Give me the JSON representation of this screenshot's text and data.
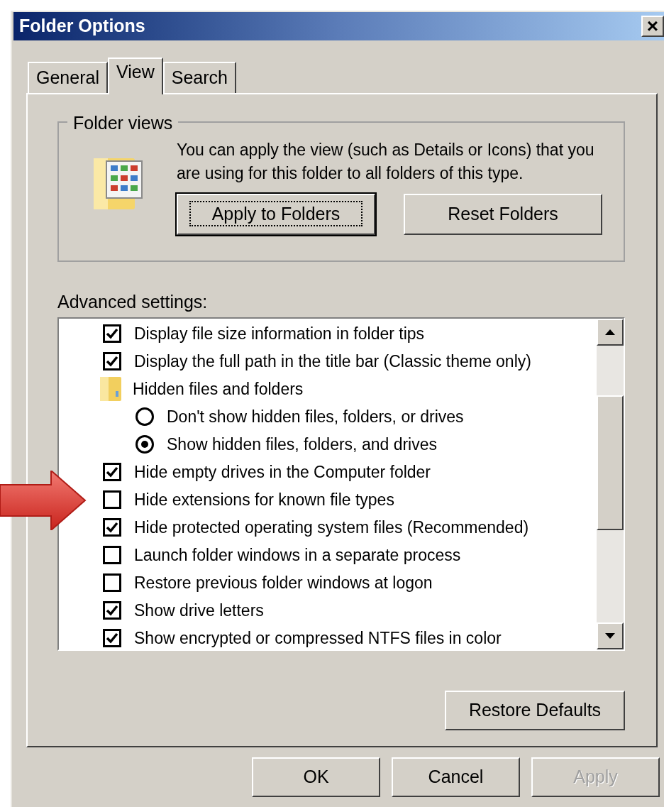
{
  "window": {
    "title": "Folder Options",
    "close": "×"
  },
  "tabs": [
    {
      "label": "General",
      "selected": false
    },
    {
      "label": "View",
      "selected": true
    },
    {
      "label": "Search",
      "selected": false
    }
  ],
  "folder_views": {
    "legend": "Folder views",
    "text": "You can apply the view (such as Details or Icons) that you are using for this folder to all folders of this type.",
    "buttons": [
      {
        "label": "Apply to Folders",
        "focused": true
      },
      {
        "label": "Reset Folders",
        "focused": false
      }
    ]
  },
  "advanced_settings": {
    "label": "Advanced settings:",
    "items": [
      {
        "kind": "checkbox",
        "label": "Display file size information in folder tips",
        "checked": true
      },
      {
        "kind": "checkbox",
        "label": "Display the full path in the title bar (Classic theme only)",
        "checked": true
      },
      {
        "kind": "group",
        "label": "Hidden files and folders",
        "children": [
          {
            "kind": "radio",
            "label": "Don't show hidden files, folders, or drives",
            "selected": false
          },
          {
            "kind": "radio",
            "label": "Show hidden files, folders, and drives",
            "selected": true
          }
        ]
      },
      {
        "kind": "checkbox",
        "label": "Hide empty drives in the Computer folder",
        "checked": true
      },
      {
        "kind": "checkbox",
        "label": "Hide extensions for known file types",
        "checked": false,
        "pointed": true
      },
      {
        "kind": "checkbox",
        "label": "Hide protected operating system files (Recommended)",
        "checked": true
      },
      {
        "kind": "checkbox",
        "label": "Launch folder windows in a separate process",
        "checked": false
      },
      {
        "kind": "checkbox",
        "label": "Restore previous folder windows at logon",
        "checked": false
      },
      {
        "kind": "checkbox",
        "label": "Show drive letters",
        "checked": true
      },
      {
        "kind": "checkbox",
        "label": "Show encrypted or compressed NTFS files in color",
        "checked": true
      }
    ]
  },
  "restore_button": {
    "label": "Restore Defaults"
  },
  "buttons": [
    {
      "label": "OK",
      "disabled": false
    },
    {
      "label": "Cancel",
      "disabled": false
    },
    {
      "label": "Apply",
      "disabled": true
    }
  ]
}
